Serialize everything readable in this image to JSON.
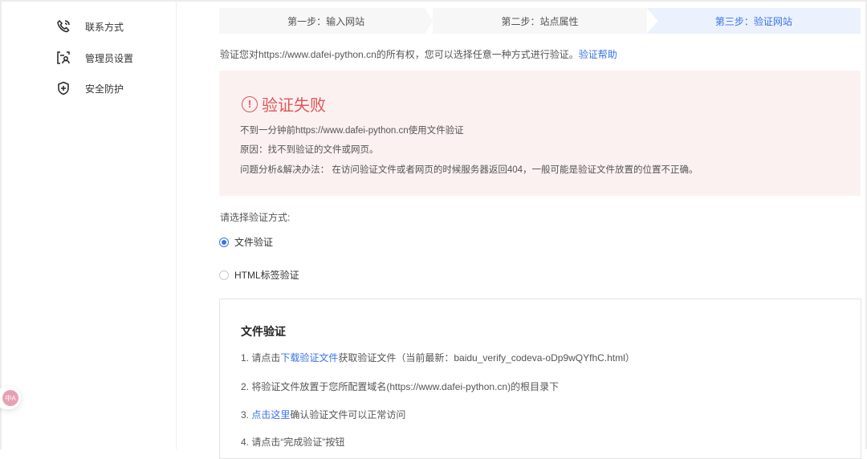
{
  "sidebar": {
    "items": [
      {
        "label": "联系方式",
        "icon": "phone-icon"
      },
      {
        "label": "管理员设置",
        "icon": "admin-icon"
      },
      {
        "label": "安全防护",
        "icon": "shield-icon"
      }
    ]
  },
  "steps": [
    "第一步：输入网站",
    "第二步：站点属性",
    "第三步：验证网站"
  ],
  "intro": {
    "text": "验证您对https://www.dafei-python.cn的所有权，您可以选择任意一种方式进行验证。",
    "help_link": "验证帮助"
  },
  "error": {
    "title": "验证失败",
    "lines": [
      "不到一分钟前https://www.dafei-python.cn使用文件验证",
      "原因：找不到验证的文件或网页。",
      "问题分析&解决办法：  在访问验证文件或者网页的时候服务器返回404，一般可能是验证文件放置的位置不正确。"
    ],
    "color": "#e05656"
  },
  "method": {
    "label": "请选择验证方式:",
    "options": [
      {
        "label": "文件验证",
        "selected": true
      },
      {
        "label": "HTML标签验证",
        "selected": false
      }
    ]
  },
  "file_verify": {
    "title": "文件验证",
    "step1": {
      "prefix": "1.  请点击",
      "link": "下载验证文件",
      "suffix": "获取验证文件（当前最新：baidu_verify_codeva-oDp9wQYfhC.html）"
    },
    "step2": "2.  将验证文件放置于您所配置域名(https://www.dafei-python.cn)的根目录下",
    "step3": {
      "prefix": "3.  ",
      "link": "点击这里",
      "suffix": "确认验证文件可以正常访问"
    },
    "step4": "4.  请点击“完成验证”按钮"
  },
  "translate_badge": "中A"
}
